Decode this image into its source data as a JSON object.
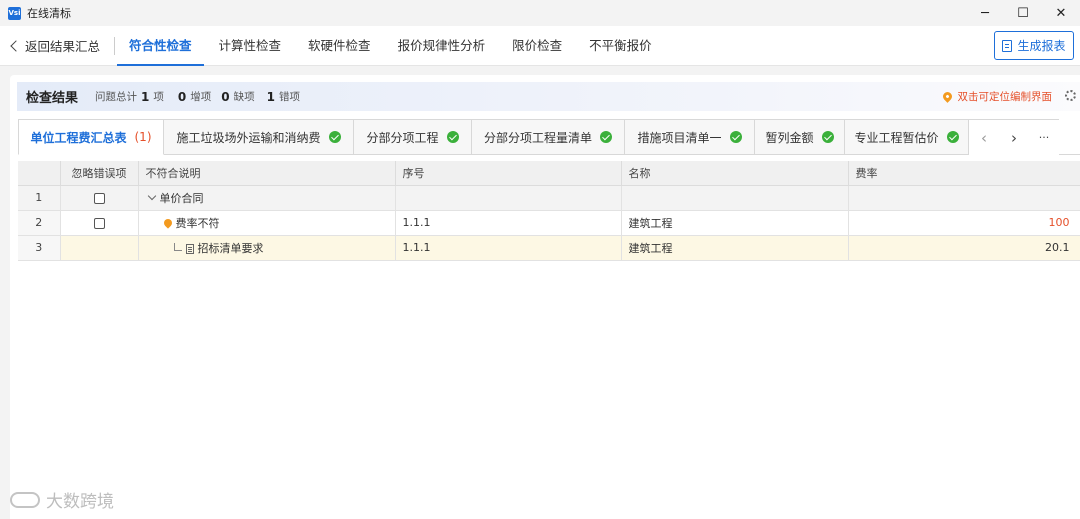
{
  "window": {
    "app_icon": "Vsi",
    "title": "在线清标",
    "controls": [
      "minimize-icon",
      "maximize-icon",
      "close-icon"
    ]
  },
  "toolbar": {
    "back_label": "返回结果汇总",
    "tabs": [
      "符合性检查",
      "计算性检查",
      "软硬件检查",
      "报价规律性分析",
      "限价检查",
      "不平衡报价"
    ],
    "active_tab": 0,
    "report_button": "生成报表",
    "accent": "#1e6fd9"
  },
  "summary": {
    "title": "检查结果",
    "problem_total_label": "问题总计",
    "problem_total": "1",
    "problem_unit": "项",
    "added": "0",
    "added_label": "增项",
    "missing": "0",
    "missing_label": "缺项",
    "wrong": "1",
    "wrong_label": "错项",
    "locate_hint": "双击可定位编制界面"
  },
  "check_tabs": [
    {
      "label": "单位工程费汇总表",
      "count": "(1)",
      "status": "error"
    },
    {
      "label": "施工垃圾场外运输和消纳费",
      "status": "ok"
    },
    {
      "label": "分部分项工程",
      "status": "ok"
    },
    {
      "label": "分部分项工程量清单",
      "status": "ok"
    },
    {
      "label": "措施项目清单一",
      "status": "ok"
    },
    {
      "label": "暂列金额",
      "status": "ok"
    },
    {
      "label": "专业工程暂估价",
      "status": "ok"
    }
  ],
  "tab_nav": {
    "prev": "‹",
    "next": "›",
    "more": "···"
  },
  "table": {
    "headers": [
      "",
      "忽略错误项",
      "不符合说明",
      "序号",
      "名称",
      "费率"
    ],
    "rows": [
      {
        "n": "1",
        "desc": "单价合同",
        "seq": "",
        "name": "",
        "rate": ""
      },
      {
        "n": "2",
        "desc": "费率不符",
        "seq": "1.1.1",
        "name": "建筑工程",
        "rate": "100"
      },
      {
        "n": "3",
        "desc": "招标清单要求",
        "seq": "1.1.1",
        "name": "建筑工程",
        "rate": "20.1"
      }
    ]
  },
  "watermark": "大数跨境"
}
